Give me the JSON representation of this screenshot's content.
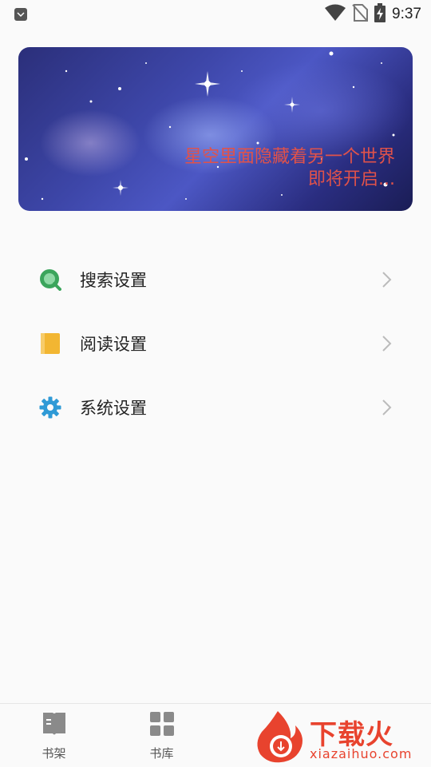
{
  "status_bar": {
    "time": "9:37",
    "icons": [
      "app-notification-icon",
      "wifi-icon",
      "no-sim-icon",
      "battery-charging-icon"
    ]
  },
  "banner": {
    "line1": "星空里面隐藏着另一个世界",
    "line2": "即将开启..."
  },
  "menu": {
    "items": [
      {
        "label": "搜索设置",
        "icon": "search-icon",
        "color": "#3ba55c"
      },
      {
        "label": "阅读设置",
        "icon": "book-icon",
        "color": "#f2b632"
      },
      {
        "label": "系统设置",
        "icon": "gear-icon",
        "color": "#2f9ad6"
      }
    ]
  },
  "bottom_nav": {
    "items": [
      {
        "label": "书架",
        "icon": "bookshelf-icon"
      },
      {
        "label": "书库",
        "icon": "library-grid-icon"
      }
    ]
  },
  "watermark": {
    "title": "下载火",
    "subtitle": "xiazaihuo.com"
  }
}
